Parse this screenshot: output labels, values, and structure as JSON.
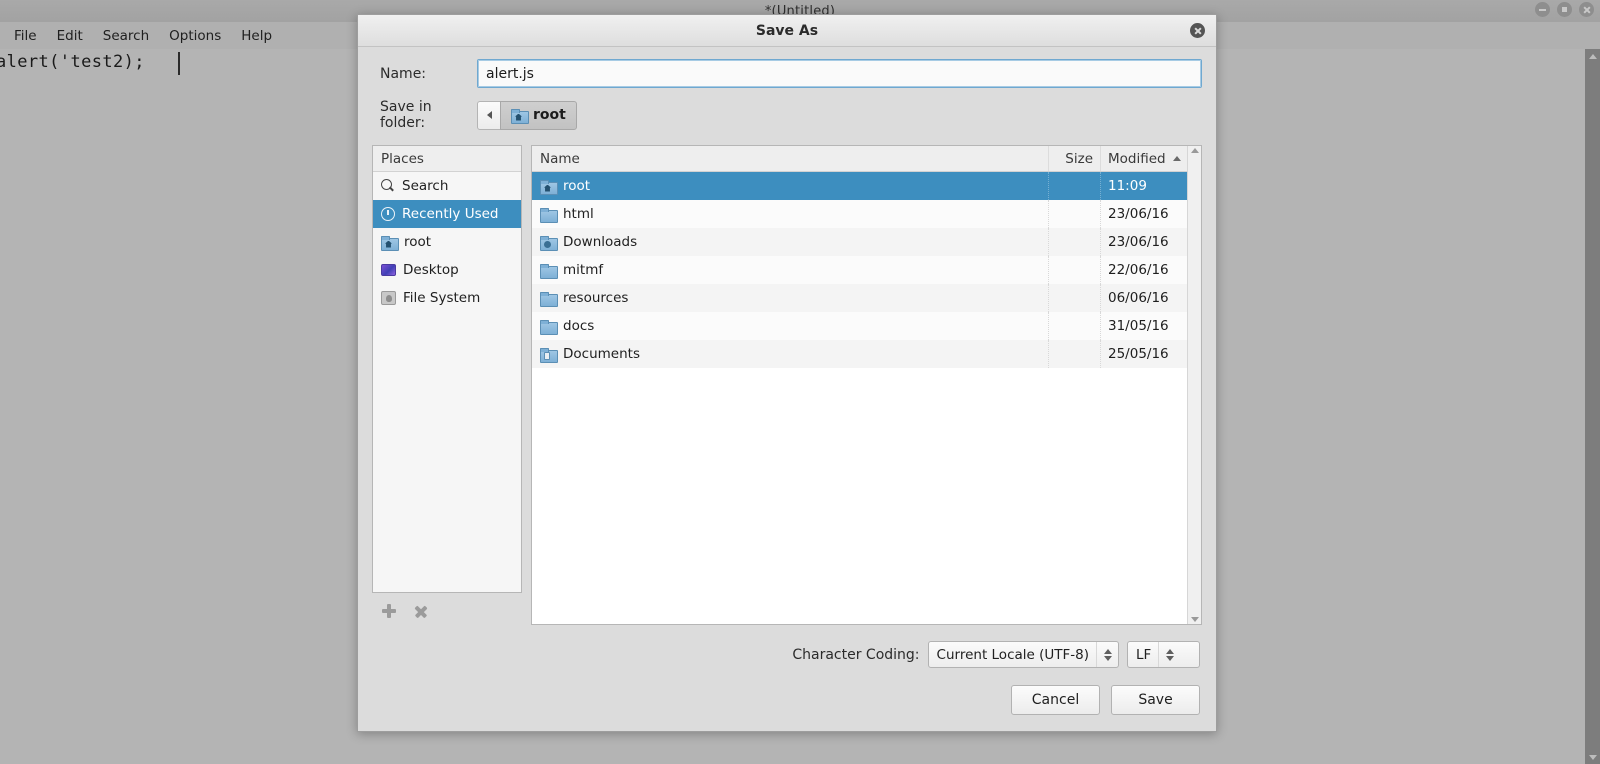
{
  "app_window": {
    "title": "*(Untitled)",
    "menu": [
      "File",
      "Edit",
      "Search",
      "Options",
      "Help"
    ],
    "editor_text": "alert('test2);",
    "window_controls": [
      "minimize",
      "maximize",
      "close"
    ]
  },
  "dialog": {
    "title": "Save As",
    "close_label": "close-icon",
    "name_label": "Name:",
    "name_value": "alert.js",
    "name_placeholder": "",
    "folder_label": "Save in folder:",
    "folder_back_label": "◀",
    "folder_crumb": "root",
    "places": {
      "header": "Places",
      "items": [
        {
          "label": "Search",
          "icon": "search-icon",
          "selected": false
        },
        {
          "label": "Recently Used",
          "icon": "recent-icon",
          "selected": true
        },
        {
          "label": "root",
          "icon": "folder-home-icon",
          "selected": false
        },
        {
          "label": "Desktop",
          "icon": "desktop-icon",
          "selected": false
        },
        {
          "label": "File System",
          "icon": "filesystem-icon",
          "selected": false
        }
      ],
      "add_label": "add-place",
      "remove_label": "remove-place"
    },
    "files": {
      "columns": [
        "Name",
        "Size",
        "Modified"
      ],
      "sort_column": "Modified",
      "sort_direction": "ascending",
      "rows": [
        {
          "name": "root",
          "size": "",
          "modified": "11:09",
          "icon": "folder-home-icon",
          "selected": true
        },
        {
          "name": "html",
          "size": "",
          "modified": "23/06/16",
          "icon": "folder-icon",
          "selected": false
        },
        {
          "name": "Downloads",
          "size": "",
          "modified": "23/06/16",
          "icon": "folder-downloads-icon",
          "selected": false
        },
        {
          "name": "mitmf",
          "size": "",
          "modified": "22/06/16",
          "icon": "folder-icon",
          "selected": false
        },
        {
          "name": "resources",
          "size": "",
          "modified": "06/06/16",
          "icon": "folder-icon",
          "selected": false
        },
        {
          "name": "docs",
          "size": "",
          "modified": "31/05/16",
          "icon": "folder-icon",
          "selected": false
        },
        {
          "name": "Documents",
          "size": "",
          "modified": "25/05/16",
          "icon": "folder-documents-icon",
          "selected": false
        }
      ]
    },
    "encoding_label": "Character Coding:",
    "encoding_value": "Current Locale (UTF-8)",
    "eol_value": "LF",
    "cancel_label": "Cancel",
    "save_label": "Save"
  },
  "colors": {
    "selection_blue": "#3d8ebf",
    "dialog_bg": "#dcdcdc",
    "window_bg": "#b4b4b4",
    "titlebar_bg": "#a9a9a9",
    "field_focus_border": "#6fa8d0"
  }
}
